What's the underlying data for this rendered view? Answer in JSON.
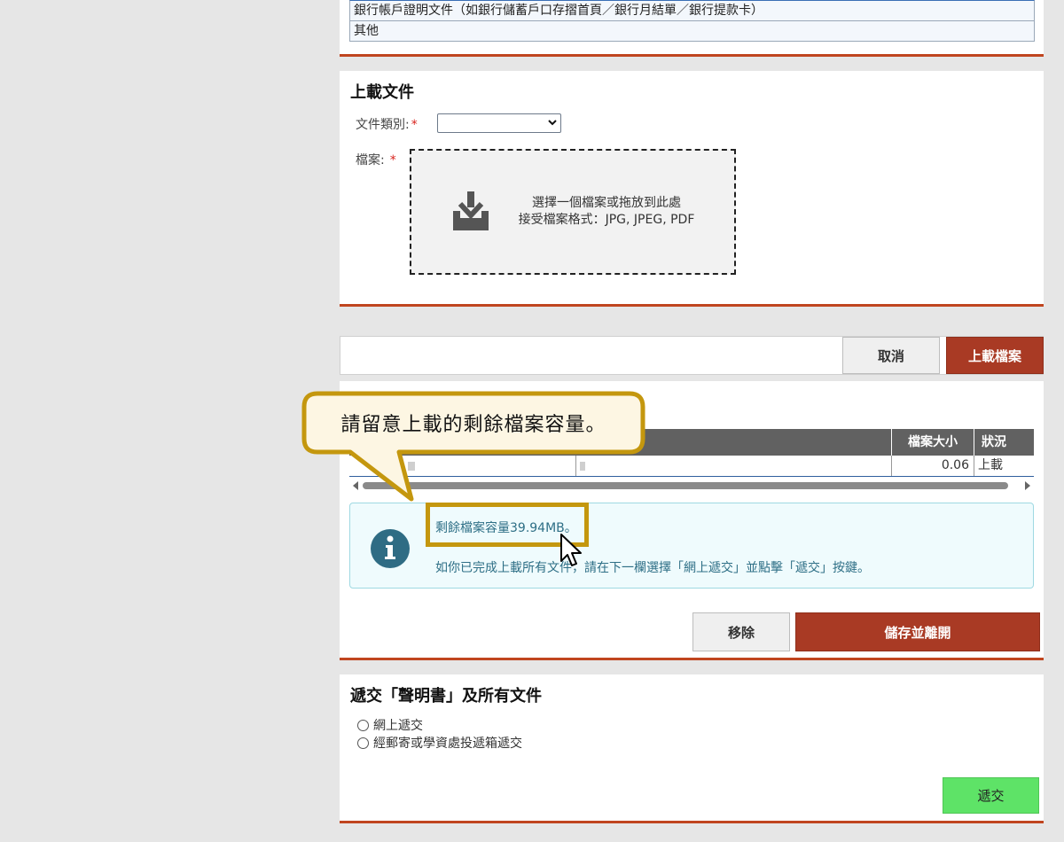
{
  "doc_types_list": [
    "銀行帳戶證明文件（如銀行儲蓄戶口存摺首頁／銀行月結單／銀行提款卡）",
    "其他"
  ],
  "upload": {
    "title": "上載文件",
    "doc_type_label": "文件類別:",
    "doc_type_value": "",
    "file_label": "檔案:",
    "required_mark": "*",
    "dropzone_line1": "選擇一個檔案或拖放到此處",
    "dropzone_line2": "接受檔案格式：JPG, JPEG, PDF"
  },
  "actions": {
    "cancel_label": "取消",
    "upload_label": "上載檔案"
  },
  "files_table": {
    "columns": [
      "檔案大小",
      "狀況"
    ],
    "rows": [
      {
        "size": "0.06",
        "status": "上載"
      }
    ]
  },
  "info": {
    "remaining": "剩餘檔案容量39.94MB。",
    "instruction": "如你已完成上載所有文件，請在下一欄選擇「網上遞交」並點擊「遞交」按鍵。"
  },
  "file_actions": {
    "remove_label": "移除",
    "save_exit_label": "儲存並離開"
  },
  "submit": {
    "title": "遞交「聲明書」及所有文件",
    "options": [
      "網上遞交",
      "經郵寄或學資處投遞箱遞交"
    ],
    "submit_label": "遞交"
  },
  "callout": {
    "text": "請留意上載的剩餘檔案容量。"
  },
  "colors": {
    "accent_red": "#a93a24",
    "divider_orange": "#c0451f",
    "callout_gold": "#c4970e",
    "submit_green": "#5ee367",
    "info_teal": "#2e6f86"
  }
}
